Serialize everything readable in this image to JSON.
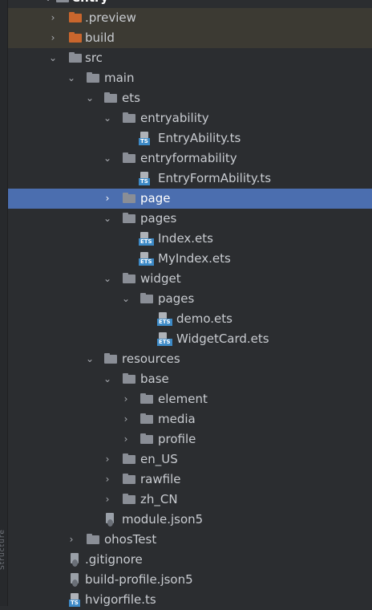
{
  "left_strip_label": "Structure",
  "tree": [
    {
      "label": "entry",
      "icon": "module-folder-icon",
      "chevron": "expanded",
      "state": "normal"
    },
    {
      "label": ".preview",
      "icon": "folder-icon",
      "chevron": "collapsed",
      "state": "excluded",
      "color": "#c9662d"
    },
    {
      "label": "build",
      "icon": "folder-icon",
      "chevron": "collapsed",
      "state": "excluded",
      "color": "#c9662d"
    },
    {
      "label": "src",
      "icon": "folder-icon",
      "chevron": "expanded",
      "state": "normal"
    },
    {
      "label": "main",
      "icon": "folder-icon",
      "chevron": "expanded",
      "state": "normal"
    },
    {
      "label": "ets",
      "icon": "folder-icon",
      "chevron": "expanded",
      "state": "normal"
    },
    {
      "label": "entryability",
      "icon": "folder-icon",
      "chevron": "expanded",
      "state": "normal"
    },
    {
      "label": "EntryAbility.ts",
      "icon": "ts-file-icon",
      "chevron": "none",
      "state": "normal"
    },
    {
      "label": "entryformability",
      "icon": "folder-icon",
      "chevron": "expanded",
      "state": "normal"
    },
    {
      "label": "EntryFormAbility.ts",
      "icon": "ts-file-icon",
      "chevron": "none",
      "state": "normal"
    },
    {
      "label": "page",
      "icon": "folder-icon",
      "chevron": "collapsed",
      "state": "selected"
    },
    {
      "label": "pages",
      "icon": "folder-icon",
      "chevron": "expanded",
      "state": "normal"
    },
    {
      "label": "Index.ets",
      "icon": "ets-file-icon",
      "chevron": "none",
      "state": "normal"
    },
    {
      "label": "MyIndex.ets",
      "icon": "ets-file-icon",
      "chevron": "none",
      "state": "normal"
    },
    {
      "label": "widget",
      "icon": "folder-icon",
      "chevron": "expanded",
      "state": "normal"
    },
    {
      "label": "pages",
      "icon": "folder-icon",
      "chevron": "expanded",
      "state": "normal"
    },
    {
      "label": "demo.ets",
      "icon": "ets-file-icon",
      "chevron": "none",
      "state": "normal"
    },
    {
      "label": "WidgetCard.ets",
      "icon": "ets-file-icon",
      "chevron": "none",
      "state": "normal"
    },
    {
      "label": "resources",
      "icon": "folder-icon",
      "chevron": "expanded",
      "state": "normal"
    },
    {
      "label": "base",
      "icon": "folder-icon",
      "chevron": "expanded",
      "state": "normal"
    },
    {
      "label": "element",
      "icon": "folder-icon",
      "chevron": "collapsed",
      "state": "normal"
    },
    {
      "label": "media",
      "icon": "folder-icon",
      "chevron": "collapsed",
      "state": "normal"
    },
    {
      "label": "profile",
      "icon": "folder-icon",
      "chevron": "collapsed",
      "state": "normal"
    },
    {
      "label": "en_US",
      "icon": "folder-icon",
      "chevron": "collapsed",
      "state": "normal"
    },
    {
      "label": "rawfile",
      "icon": "folder-icon",
      "chevron": "collapsed",
      "state": "normal"
    },
    {
      "label": "zh_CN",
      "icon": "folder-icon",
      "chevron": "collapsed",
      "state": "normal"
    },
    {
      "label": "module.json5",
      "icon": "json-file-icon",
      "chevron": "none",
      "state": "normal"
    },
    {
      "label": "ohosTest",
      "icon": "folder-icon",
      "chevron": "collapsed",
      "state": "normal"
    },
    {
      "label": ".gitignore",
      "icon": "gitignore-file-icon",
      "chevron": "none",
      "state": "normal"
    },
    {
      "label": "build-profile.json5",
      "icon": "json-file-icon",
      "chevron": "none",
      "state": "normal"
    },
    {
      "label": "hvigorfile.ts",
      "icon": "ts-file-icon",
      "chevron": "none",
      "state": "normal"
    }
  ]
}
